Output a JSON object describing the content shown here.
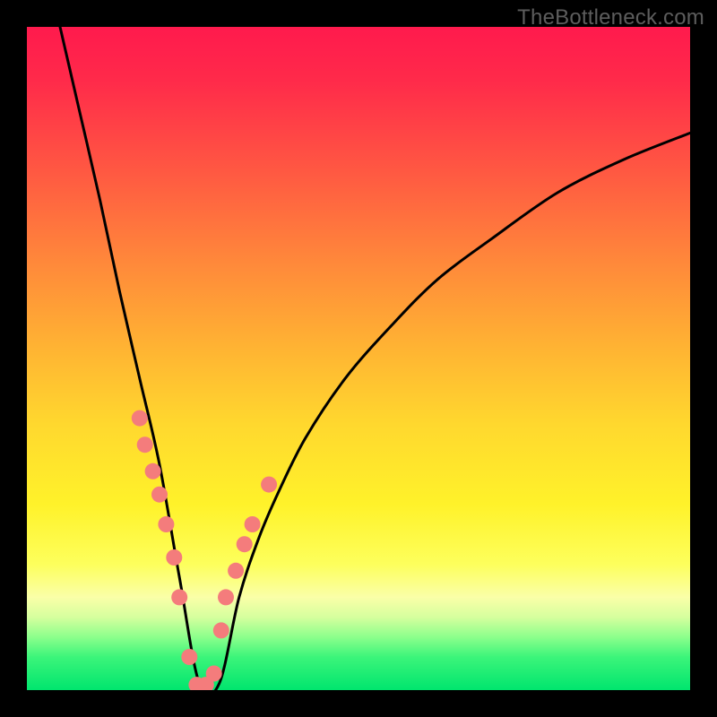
{
  "attribution": "TheBottleneck.com",
  "chart_data": {
    "type": "line",
    "title": "",
    "xlabel": "",
    "ylabel": "",
    "xlim": [
      0,
      100
    ],
    "ylim": [
      0,
      100
    ],
    "note": "V-shaped bottleneck curve over red→green vertical gradient background. The curve hits its minimum near x≈26 where it touches the green band (y≈0). Salmon-colored dots mark selected points along the lower portion of both arms of the V.",
    "series": [
      {
        "name": "bottleneck-curve",
        "x": [
          5,
          8,
          11,
          14,
          17,
          20,
          23,
          26,
          29,
          32,
          35,
          38,
          42,
          48,
          55,
          62,
          70,
          80,
          90,
          100
        ],
        "y": [
          100,
          87,
          74,
          60,
          47,
          34,
          17,
          1,
          1,
          14,
          23,
          30,
          38,
          47,
          55,
          62,
          68,
          75,
          80,
          84
        ]
      }
    ],
    "points": {
      "name": "highlighted-points",
      "color": "#f47c7c",
      "x": [
        17.0,
        17.8,
        19.0,
        20.0,
        21.0,
        22.2,
        23.0,
        24.5,
        25.6,
        27.0,
        28.2,
        29.3,
        30.0,
        31.5,
        32.8,
        34.0,
        36.5
      ],
      "y": [
        41.0,
        37.0,
        33.0,
        29.5,
        25.0,
        20.0,
        14.0,
        5.0,
        0.8,
        0.8,
        2.5,
        9.0,
        14.0,
        18.0,
        22.0,
        25.0,
        31.0
      ]
    }
  }
}
